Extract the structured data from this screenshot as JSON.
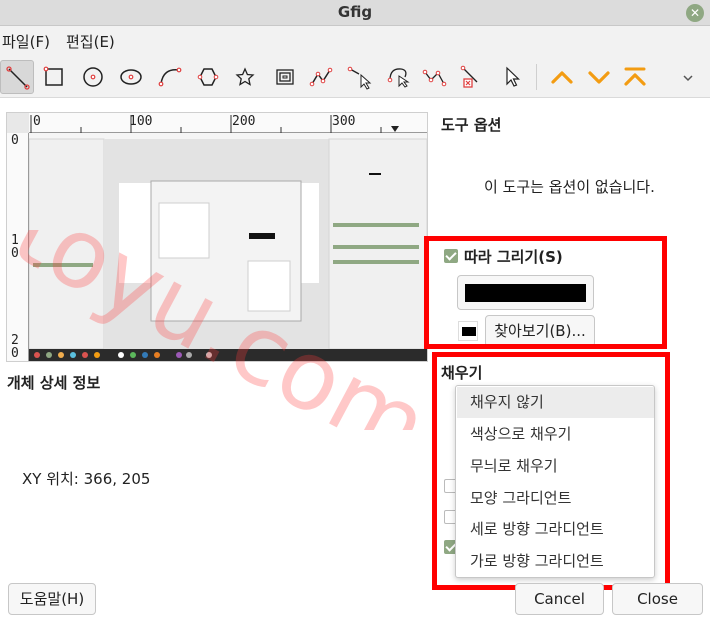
{
  "window": {
    "title": "Gfig"
  },
  "menu": {
    "file": "파일(F)",
    "edit": "편집(E)"
  },
  "toolbar": {
    "tools": [
      "line-tool",
      "rectangle-tool",
      "circle-tool",
      "ellipse-tool",
      "arc-tool",
      "polygon-tool",
      "star-tool",
      "spiral-tool",
      "bezier-tool",
      "move-object-tool",
      "move-point-tool",
      "copy-object-tool",
      "delete-object-tool",
      "select-object-tool"
    ],
    "raise_label": "^",
    "lower_label": "v",
    "top_label": "⊼"
  },
  "ruler": {
    "top_ticks": [
      "0",
      "100",
      "200",
      "300"
    ],
    "left_ticks": [
      "1",
      "2"
    ],
    "left_small": [
      "0",
      "0",
      "0"
    ]
  },
  "tool_options": {
    "title": "도구 옵션",
    "message": "이 도구는 옵션이 없습니다."
  },
  "object_details": {
    "title": "개체 상세 정보",
    "xy": "XY 위치: 366, 205"
  },
  "stroke": {
    "label": "따라 그리기(S)",
    "browse_label": "찾아보기(B)...",
    "color": "#000000"
  },
  "fill": {
    "title": "채우기",
    "options": [
      "채우지 않기",
      "색상으로 채우기",
      "무늬로 채우기",
      "모양 그라디언트",
      "세로 방향 그라디언트",
      "가로 방향 그라디언트"
    ],
    "selected": "채우지 않기"
  },
  "buttons": {
    "help": "도움말(H)",
    "cancel": "Cancel",
    "close": "Close"
  },
  "watermark": {
    "text": "toyu.com"
  },
  "colors": {
    "accent": "#8fa883",
    "highlight": "#ff0000",
    "toolbar_orange": "#f39c12"
  }
}
